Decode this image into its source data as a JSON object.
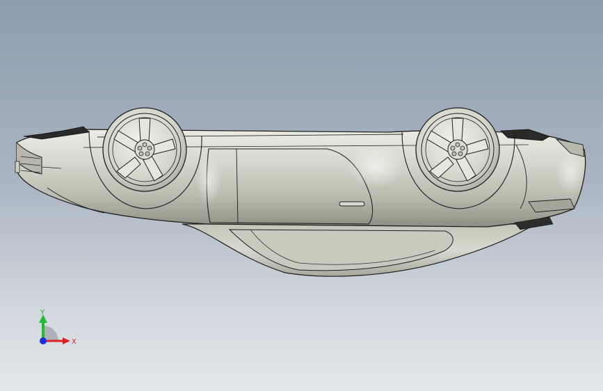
{
  "viewport": {
    "background_top": "#8d9cae",
    "background_bottom": "#e3e7ea"
  },
  "model": {
    "icon": "car-body-upside-down",
    "body_color": "#cfcfc4",
    "edge_color": "#1e1e1e"
  },
  "triad": {
    "x_label": "X",
    "y_label": "Y",
    "x_color": "#e02020",
    "y_color": "#22bb33",
    "z_color": "#1a2ee0"
  }
}
